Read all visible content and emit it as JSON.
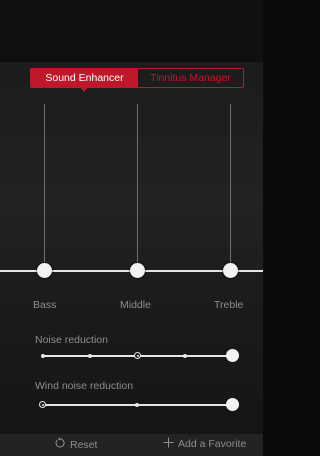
{
  "tabs": {
    "sound_enhancer": "Sound Enhancer",
    "tinnitus_manager": "Tinnitus Manager"
  },
  "equalizer": {
    "bands": [
      {
        "label": "Bass"
      },
      {
        "label": "Middle"
      },
      {
        "label": "Treble"
      }
    ]
  },
  "noise_reduction": {
    "label": "Noise reduction",
    "steps": 5,
    "current_step": 3
  },
  "wind_noise_reduction": {
    "label": "Wind noise reduction",
    "steps": 3,
    "current_step": 1
  },
  "footer": {
    "reset_label": "Reset",
    "reset_icon": "reset-icon",
    "favorite_label": "Add a Favorite",
    "favorite_icon": "plus-icon"
  },
  "colors": {
    "accent": "#c0182b",
    "background": "#1c1c1c"
  }
}
